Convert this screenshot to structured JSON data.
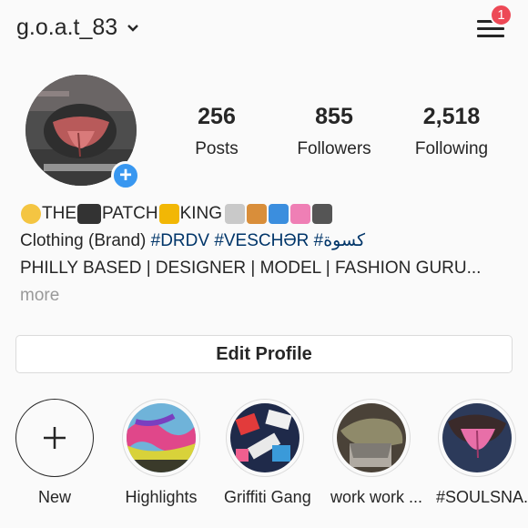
{
  "header": {
    "username": "g.o.a.t_83",
    "notification_count": "1"
  },
  "stats": [
    {
      "value": "256",
      "label": "Posts"
    },
    {
      "value": "855",
      "label": "Followers"
    },
    {
      "value": "2,518",
      "label": "Following"
    }
  ],
  "bio": {
    "line1_parts": [
      "THE ",
      "PATCH",
      " KING"
    ],
    "line2_text": "Clothing (Brand) ",
    "line2_tags": [
      "#DRDV",
      "#VESCHƏR",
      "#كسوة"
    ],
    "line3": "PHILLY BASED | DESIGNER | MODEL | FASHION GURU...",
    "more": "more"
  },
  "edit_profile_label": "Edit Profile",
  "highlights": [
    {
      "name": "New"
    },
    {
      "name": "Highlights"
    },
    {
      "name": "Griffiti Gang"
    },
    {
      "name": "work work ..."
    },
    {
      "name": "#SOULSNA..."
    }
  ],
  "colors": {
    "accent": "#3897f0",
    "badge": "#ed4956",
    "hashtag": "#003569"
  }
}
